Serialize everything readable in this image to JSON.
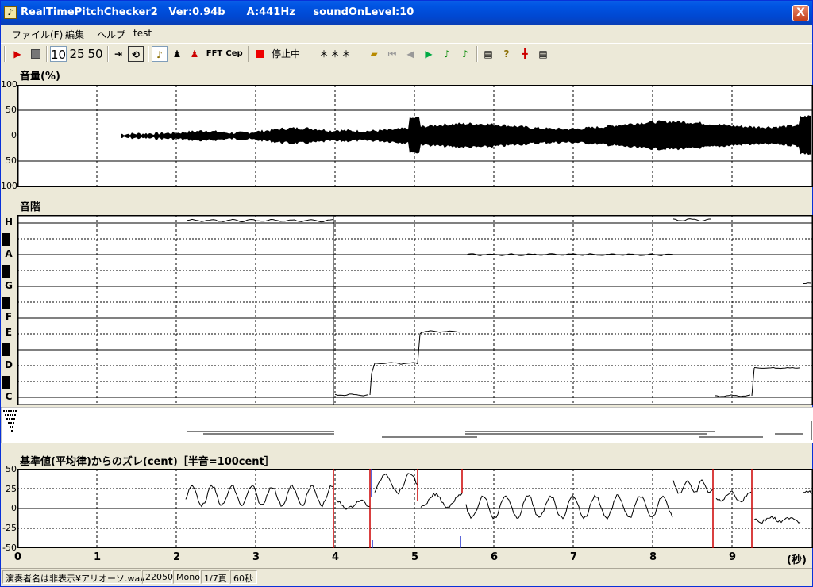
{
  "window": {
    "title": "RealTimePitchChecker2   Ver:0.94b      A:441Hz     soundOnLevel:10",
    "close_label": "X"
  },
  "menu": {
    "items": [
      "ファイル(F)",
      "編集",
      "ヘルプ",
      "test"
    ]
  },
  "toolbar": {
    "speed_10": "10",
    "speed_25": "25",
    "speed_50": "50",
    "fft_label": "FFT",
    "cep_label": "Cep",
    "status_text": "停止中",
    "note_display": "＊＊＊"
  },
  "volume_panel": {
    "title": "音量(%)",
    "y_ticks": [
      "100",
      "50",
      "0",
      "50",
      "100"
    ]
  },
  "scale_panel": {
    "title": "音階",
    "notes": [
      "H",
      "A",
      "G",
      "F",
      "E",
      "D",
      "C"
    ]
  },
  "deviation_panel": {
    "title": "基準値(平均律)からのズレ(cent)［半音=100cent］",
    "y_ticks": [
      "50",
      "25",
      "0",
      "-25",
      "-50"
    ]
  },
  "x_axis": {
    "ticks": [
      "0",
      "1",
      "2",
      "3",
      "4",
      "5",
      "6",
      "7",
      "8",
      "9"
    ],
    "unit_label": "(秒)"
  },
  "statusbar": {
    "file": "演奏者名は非表示¥アリオーソ.wav",
    "rate": "22050",
    "channel": "Mono",
    "page": "1/7頁",
    "duration": "60秒"
  },
  "colors": {
    "titlebar": "#0054e3",
    "plot_bg": "#ffffff",
    "trace": "#000000",
    "marker_red": "#cc0000",
    "marker_blue": "#2233cc"
  }
}
